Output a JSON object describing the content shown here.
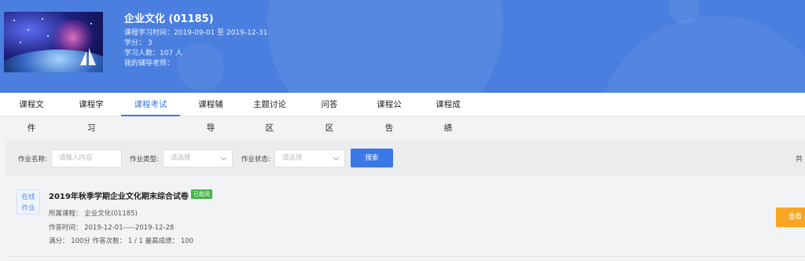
{
  "course": {
    "title": "企业文化 (01185)",
    "period": "课程学习时间：2019-09-01 至 2019-12-31",
    "credits": "学分： 3",
    "learners": "学习人数：107 人",
    "tutor": "我的辅导老师："
  },
  "tabs": [
    {
      "label": "课程文件",
      "active": false
    },
    {
      "label": "课程学习",
      "active": false
    },
    {
      "label": "课程考试",
      "active": true
    },
    {
      "label": "课程辅导",
      "active": false
    },
    {
      "label": "主题讨论区",
      "active": false
    },
    {
      "label": "问答区",
      "active": false
    },
    {
      "label": "课程公告",
      "active": false
    },
    {
      "label": "课程成绩",
      "active": false
    }
  ],
  "filter": {
    "name_label": "作业名称:",
    "name_placeholder": "请输入内容",
    "type_label": "作业类型:",
    "type_placeholder": "请选择",
    "status_label": "作业状态:",
    "status_placeholder": "请选择",
    "search_label": "搜索",
    "total_label": "共"
  },
  "assignment": {
    "type_line1": "在线",
    "type_line2": "作业",
    "title": "2019年秋季学期企业文化期末综合试卷",
    "status": "已批阅",
    "course_line": "所属课程： 企业文化(01185)",
    "time_line": "作答时间： 2019-12-01-----2019-12-28",
    "score_line": "满分： 100分    作答次数： 1 / 1    最高成绩： 100",
    "view_label": "查看",
    "colors": {
      "accent": "#3b78e7",
      "status": "#44b549",
      "view": "#f6a623",
      "banner": "#4a7fe0"
    }
  }
}
